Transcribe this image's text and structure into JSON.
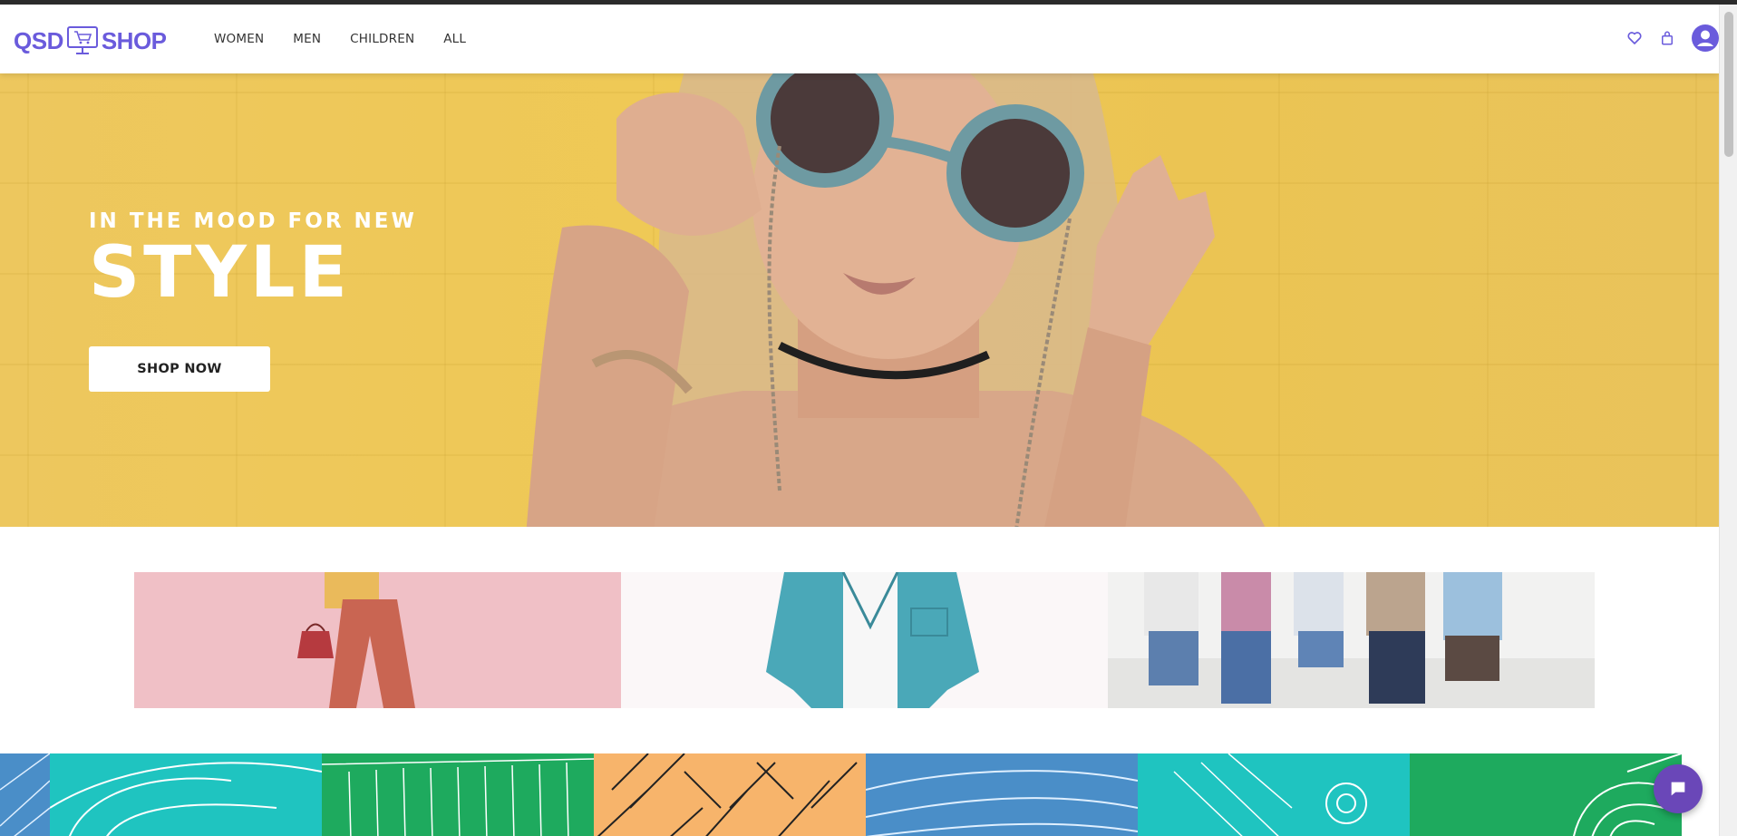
{
  "header": {
    "logo_left": "QSD",
    "logo_right": "SHOP",
    "nav": [
      "WOMEN",
      "MEN",
      "CHILDREN",
      "ALL"
    ]
  },
  "icons": {
    "wishlist": "heart-icon",
    "cart": "shopping-bag-icon",
    "account": "user-avatar-icon",
    "chat": "chat-bubble-icon"
  },
  "hero": {
    "subtitle": "IN THE MOOD FOR NEW",
    "title": "STYLE",
    "button_label": "SHOP NOW"
  },
  "categories": [
    "women",
    "men",
    "children"
  ],
  "colors": {
    "brand": "#6a5bdc",
    "hero_background": "#efc955",
    "chat_button": "#6a47b8",
    "pattern_teal": "#1fc4c0",
    "pattern_green": "#1eaa5e",
    "pattern_orange": "#f7b46b",
    "pattern_blue": "#4a8ec8"
  }
}
